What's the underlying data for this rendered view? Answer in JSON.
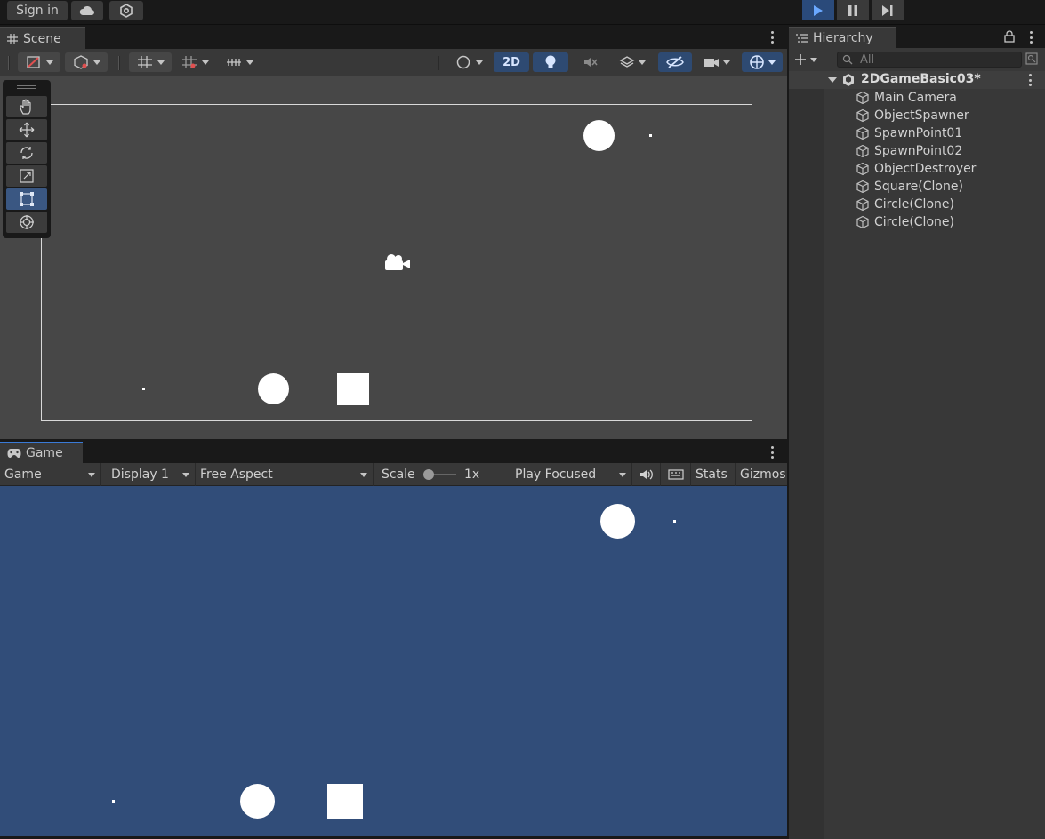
{
  "topbar": {
    "sign_in_label": "Sign in",
    "cloud_icon": "cloud-icon",
    "collab_icon": "collab-icon",
    "play_icon": "play-icon",
    "pause_icon": "pause-icon",
    "step_icon": "step-icon",
    "play_accent": "#2a4a7a"
  },
  "scene": {
    "tab_label": "Scene",
    "toolbar": {
      "mode_2d_label": "2D"
    }
  },
  "game": {
    "tab_label": "Game",
    "view_select": "Game",
    "display_select": "Display 1",
    "aspect_select": "Free Aspect",
    "scale_label": "Scale",
    "scale_value": "1x",
    "play_mode_select": "Play Focused",
    "stats_label": "Stats",
    "gizmos_label": "Gizmos",
    "background_color": "#314d79"
  },
  "hierarchy": {
    "tab_label": "Hierarchy",
    "search_placeholder": "All",
    "scene_name": "2DGameBasic03*",
    "items": [
      "Main Camera",
      "ObjectSpawner",
      "SpawnPoint01",
      "SpawnPoint02",
      "ObjectDestroyer",
      "Square(Clone)",
      "Circle(Clone)",
      "Circle(Clone)"
    ]
  }
}
